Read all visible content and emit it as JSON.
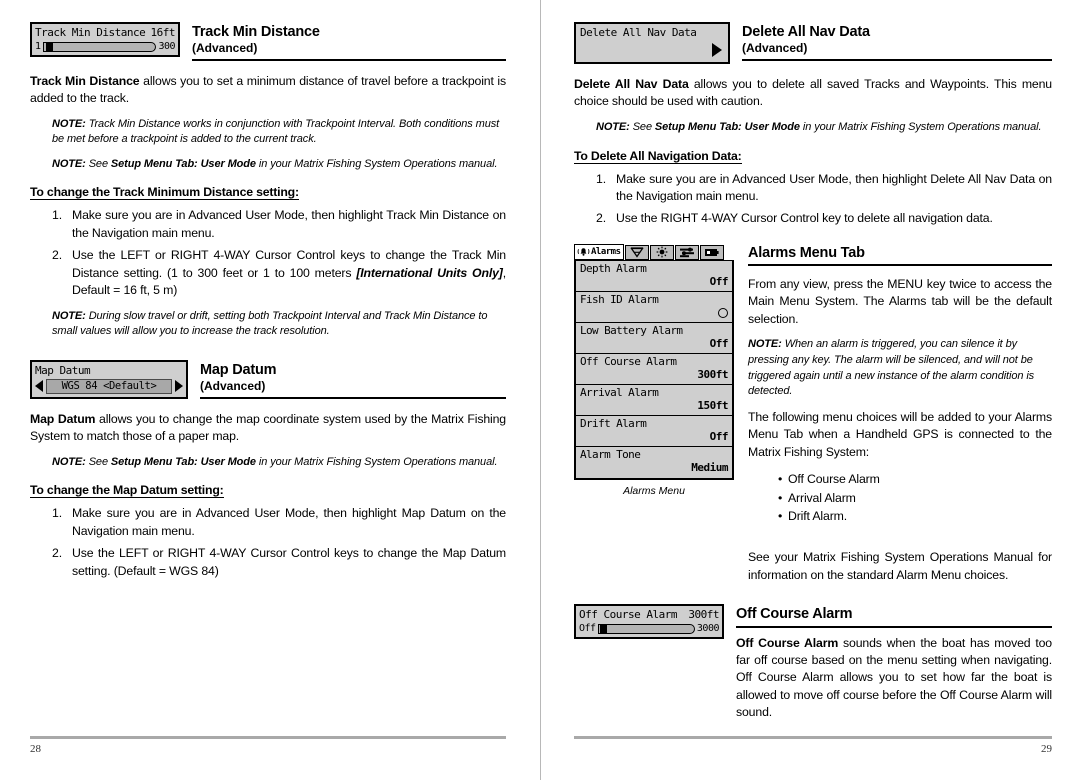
{
  "left_page": {
    "page_number": "28",
    "sections": [
      {
        "lcd": {
          "label": "Track Min Distance",
          "value": "16ft",
          "bar_min": "1",
          "bar_max": "300"
        },
        "title": "Track Min Distance",
        "subtitle": "(Advanced)",
        "intro_bold": "Track Min Distance",
        "intro_rest": " allows you to set a minimum distance of travel before a trackpoint is added to the track.",
        "note1_label": "NOTE:",
        "note1_a": " Track Min Distance works in conjunction with Trackpoint Interval.  Both conditions must be met before a trackpoint is added to the current track.",
        "note2_label": "NOTE:",
        "note2_a": " See ",
        "note2_bold": "Setup Menu Tab: User Mode",
        "note2_b": " in your Matrix Fishing System Operations manual.",
        "howto": "To change the Track Minimum Distance setting:",
        "step1": "Make sure you are in Advanced User Mode, then highlight Track Min Distance on the Navigation main menu.",
        "step2_a": "Use the LEFT or RIGHT 4-WAY Cursor Control keys to change the Track Min Distance setting. (1 to 300 feet or 1 to 100 meters ",
        "step2_italic": "[International Units Only]",
        "step2_b": ", Default = 16 ft, 5 m)",
        "note3_label": "NOTE:",
        "note3_a": " During slow travel or drift, setting both Trackpoint Interval and Track Min Distance to small values will allow you to increase the track resolution."
      },
      {
        "lcd": {
          "label": "Map Datum",
          "value": "WGS 84 <Default>"
        },
        "title": "Map Datum",
        "subtitle": "(Advanced)",
        "intro_bold": "Map Datum",
        "intro_rest": " allows you to change the map coordinate system used by the  Matrix Fishing System to match those of a paper map.",
        "note1_label": "NOTE:",
        "note1_a": " See ",
        "note1_bold": "Setup Menu Tab: User Mode",
        "note1_b": " in your Matrix Fishing System Operations manual.",
        "howto": "To change the Map Datum setting:",
        "step1": "Make sure you are in Advanced User Mode, then highlight Map Datum on the Navigation main menu.",
        "step2": "Use the LEFT or RIGHT 4-WAY Cursor Control keys to change the Map Datum setting. (Default = WGS 84)"
      }
    ]
  },
  "right_page": {
    "page_number": "29",
    "delete_nav": {
      "lcd_label": "Delete All Nav Data",
      "title": "Delete All Nav Data",
      "subtitle": "(Advanced)",
      "intro_bold": "Delete All Nav Data",
      "intro_rest": " allows you to delete all saved Tracks and Waypoints.  This menu choice should be used with caution.",
      "note_label": "NOTE:",
      "note_a": " See ",
      "note_bold": "Setup Menu Tab: User Mode",
      "note_b": " in your Matrix Fishing System Operations manual.",
      "howto": "To Delete All Navigation Data:",
      "step1": "Make sure you are in Advanced User Mode, then highlight Delete All Nav Data on the Navigation main menu.",
      "step2": "Use the RIGHT 4-WAY Cursor Control key to delete all navigation data."
    },
    "alarms": {
      "tab_label": "Alarms",
      "menu_items": [
        {
          "label": "Depth Alarm",
          "value": "Off"
        },
        {
          "label": "Fish ID Alarm",
          "value": ""
        },
        {
          "label": "Low Battery Alarm",
          "value": "Off"
        },
        {
          "label": "Off Course Alarm",
          "value": "300ft"
        },
        {
          "label": "Arrival Alarm",
          "value": "150ft"
        },
        {
          "label": "Drift Alarm",
          "value": "Off"
        },
        {
          "label": "Alarm Tone",
          "value": "Medium"
        }
      ],
      "caption": "Alarms Menu",
      "title": "Alarms Menu Tab",
      "para1": "From any view, press the MENU key twice to access the Main Menu System. The Alarms tab will be the default selection.",
      "note_label": "NOTE:",
      "note_a": " When an alarm is triggered, you can silence it by pressing any key.  The alarm will be silenced, and will not be triggered again until a new instance of the alarm condition is detected.",
      "para2": "The following menu choices will be added to your Alarms Menu Tab when a Handheld GPS is connected to the Matrix Fishing System:",
      "bullets": [
        "Off Course Alarm",
        "Arrival Alarm",
        "Drift Alarm."
      ],
      "para3": "See your Matrix Fishing System Operations Manual for information on the standard Alarm Menu choices."
    },
    "off_course": {
      "lcd": {
        "label": "Off Course Alarm",
        "value": "300ft",
        "bar_min": "Off",
        "bar_max": "3000"
      },
      "title": "Off Course Alarm",
      "intro_bold": "Off Course Alarm",
      "intro_rest": " sounds when the boat has moved too far off course based on the menu setting when navigating. Off Course Alarm allows you to set how far the boat is allowed to move off course before the Off Course Alarm will sound."
    }
  }
}
